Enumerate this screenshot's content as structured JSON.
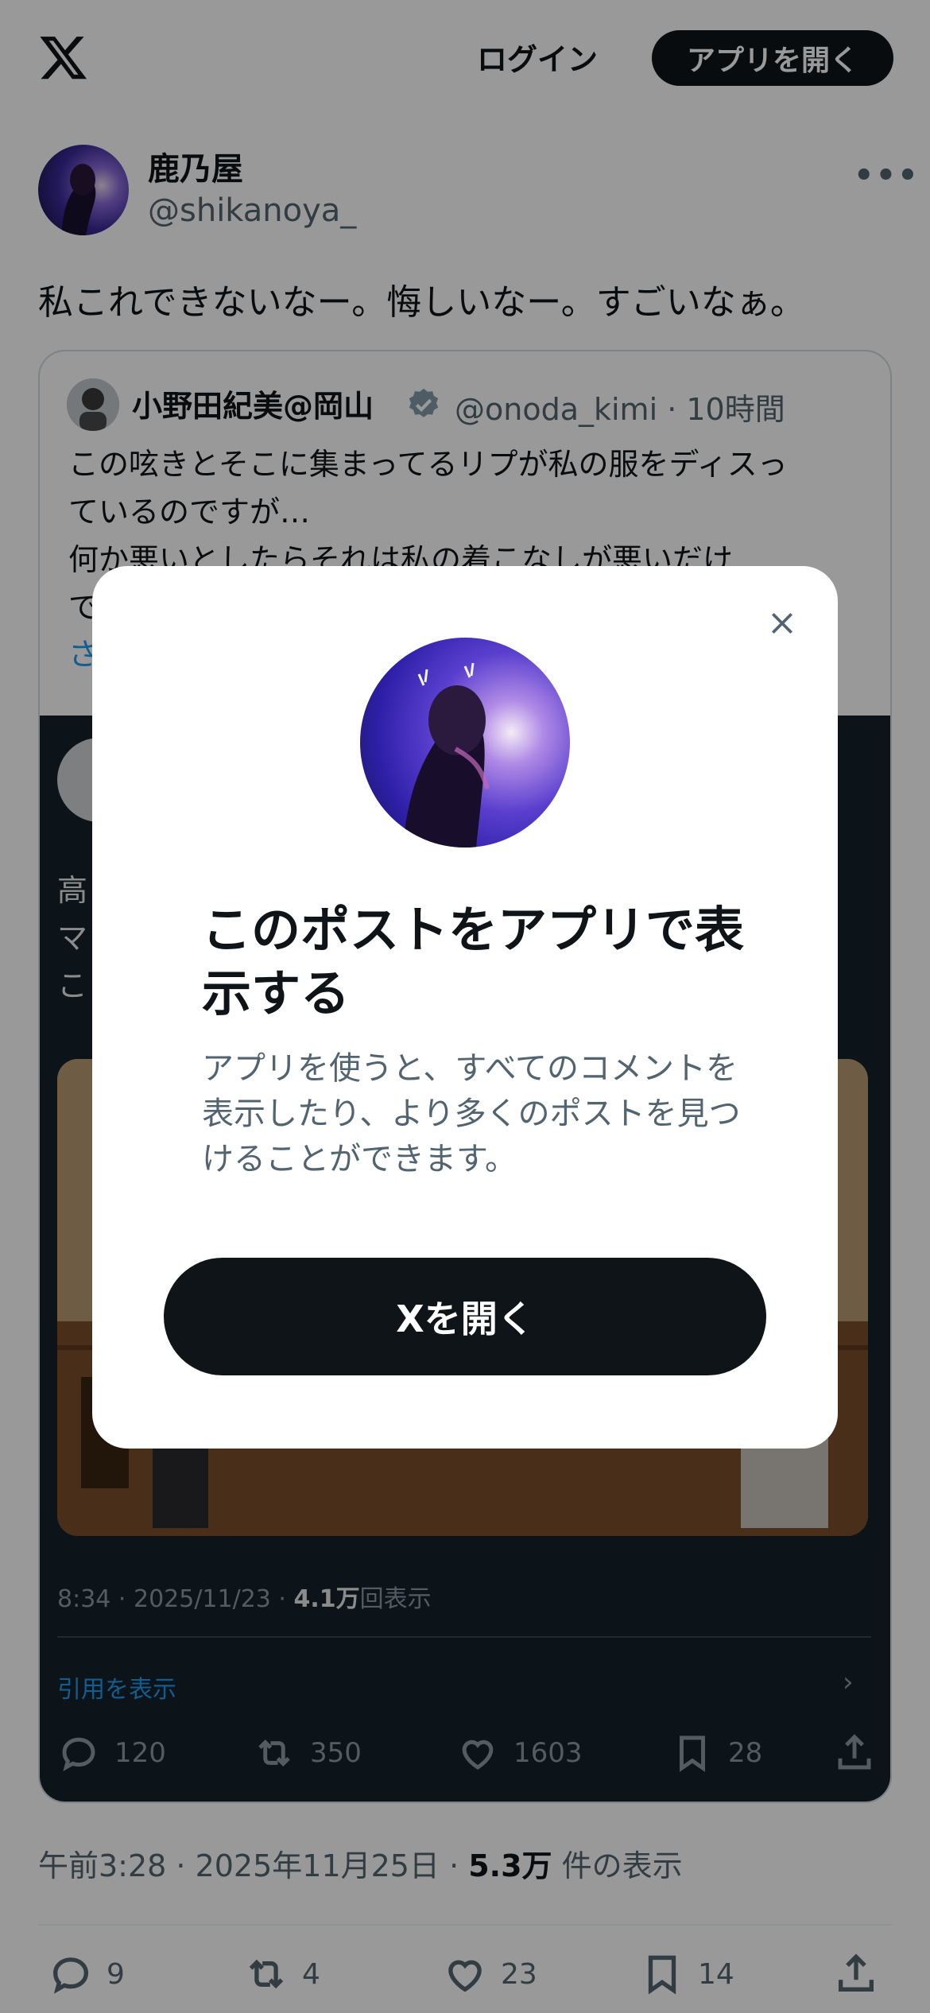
{
  "topbar": {
    "logo_icon": "x-logo-icon",
    "login_label": "ログイン",
    "open_app_label": "アプリを開く"
  },
  "post": {
    "author_name": "鹿乃屋",
    "author_handle": "@shikanoya_",
    "more_icon": "more-icon",
    "text": "私これできないなー。悔しいなー。すごいなぁ。",
    "time": "午前3:28 · 2025年11月25日 · ",
    "views_count": "5.3万",
    "views_label": " 件の表示",
    "actions": {
      "replies": "9",
      "reposts": "4",
      "likes": "23",
      "bookmarks": "14"
    }
  },
  "quote": {
    "name": "小野田紀美@岡山",
    "handle_time": "@onoda_kimi · 10時間",
    "verified_icon": "verified-badge-icon",
    "text_line1": "この呟きとそこに集まってるリプが私の服をディスっ",
    "text_line2": "ているのですが…",
    "text_line3": "何か悪いとしたらそれは私の着こなしが悪いだけ",
    "text_line4": "で",
    "show_more": "さ",
    "embedded": {
      "text_line1": "高",
      "text_line2": "マ",
      "text_line3": "こ",
      "meta_prefix": "8:34 · 2025/11/23 · ",
      "meta_views": "4.1万",
      "meta_suffix": "回表示",
      "view_quotes": "引用を表示",
      "actions": {
        "replies": "120",
        "reposts": "350",
        "likes": "1603",
        "bookmarks": "28"
      }
    }
  },
  "modal": {
    "close_icon": "close-icon",
    "title": "このポストをアプリで表示する",
    "description": "アプリを使うと、すべてのコメントを表示したり、より多くのポストを見つけることができます。",
    "button_label": "Xを開く"
  }
}
